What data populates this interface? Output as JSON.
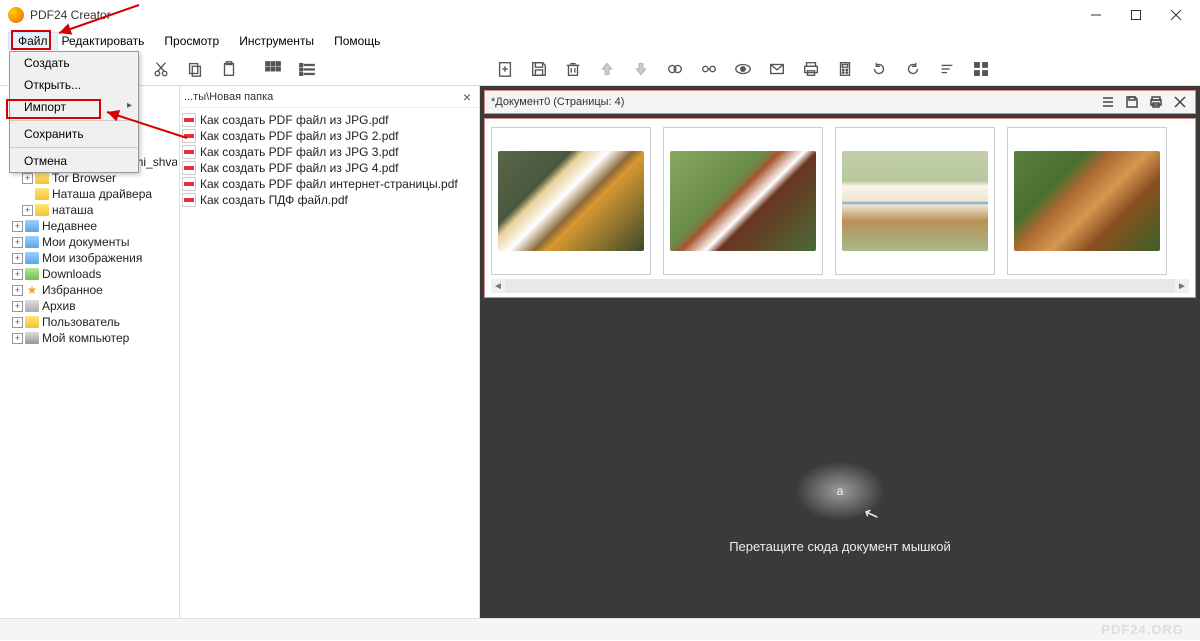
{
  "app": {
    "title": "PDF24 Creator"
  },
  "menubar": [
    "Файл",
    "Редактировать",
    "Просмотр",
    "Инструменты",
    "Помощь"
  ],
  "dropdown": {
    "create": "Создать",
    "open": "Открыть...",
    "import": "Импорт",
    "save": "Сохранить",
    "cancel": "Отмена"
  },
  "path": "...ты\\Новая папка",
  "tree": [
    {
      "name": "plate_s_relefnymi_shvami",
      "exp": true,
      "icon": "folder-y",
      "indent": 2
    },
    {
      "name": "Tor Browser",
      "exp": true,
      "icon": "folder-y",
      "indent": 2
    },
    {
      "name": "Наташа драйвера",
      "exp": false,
      "icon": "folder-y",
      "indent": 2
    },
    {
      "name": "наташа",
      "exp": true,
      "icon": "folder-y",
      "indent": 2
    },
    {
      "name": "Недавнее",
      "exp": true,
      "icon": "folder-b",
      "indent": 1
    },
    {
      "name": "Мои документы",
      "exp": true,
      "icon": "folder-b",
      "indent": 1
    },
    {
      "name": "Мои изображения",
      "exp": true,
      "icon": "folder-b",
      "indent": 1
    },
    {
      "name": "Downloads",
      "exp": true,
      "icon": "folder-g",
      "indent": 1
    },
    {
      "name": "Избранное",
      "exp": true,
      "icon": "star-i",
      "indent": 1
    },
    {
      "name": "Архив",
      "exp": true,
      "icon": "folder-gr",
      "indent": 1
    },
    {
      "name": "Пользователь",
      "exp": true,
      "icon": "folder-y",
      "indent": 1
    },
    {
      "name": "Мой компьютер",
      "exp": true,
      "icon": "pc-i",
      "indent": 1
    }
  ],
  "files": [
    "Как создать PDF файл из JPG.pdf",
    "Как создать PDF файл из JPG 2.pdf",
    "Как создать PDF файл из JPG 3.pdf",
    "Как создать PDF файл из JPG 4.pdf",
    "Как создать PDF файл интернет-страницы.pdf",
    "Как создать ПДФ файл.pdf"
  ],
  "document": {
    "title": "*Документ0 (Страницы: 4)"
  },
  "thumbs": [
    "eagle",
    "redpanda",
    "cat",
    "lion"
  ],
  "dropzone": {
    "text": "Перетащите сюда документ мышкой",
    "logo": "a"
  },
  "watermark": "PDF24.ORG"
}
